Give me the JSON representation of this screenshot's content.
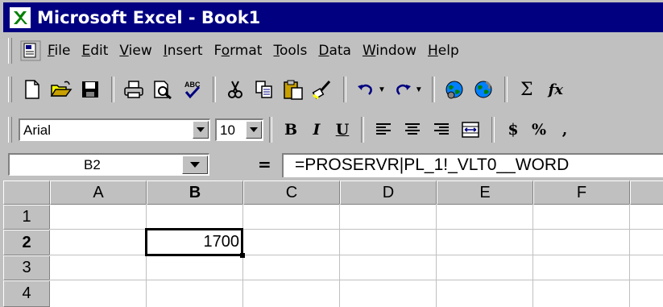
{
  "window": {
    "title": "Microsoft Excel - Book1",
    "accent": "#000080"
  },
  "menu": {
    "items": [
      {
        "label_u": "F",
        "label_rest": "ile"
      },
      {
        "label_u": "E",
        "label_rest": "dit"
      },
      {
        "label_u": "V",
        "label_rest": "iew"
      },
      {
        "label_u": "I",
        "label_rest": "nsert"
      },
      {
        "label_pre": "F",
        "label_u": "o",
        "label_rest": "rmat"
      },
      {
        "label_u": "T",
        "label_rest": "ools"
      },
      {
        "label_u": "D",
        "label_rest": "ata"
      },
      {
        "label_u": "W",
        "label_rest": "indow"
      },
      {
        "label_u": "H",
        "label_rest": "elp"
      }
    ]
  },
  "toolbar": {
    "icons": [
      "new-icon",
      "open-icon",
      "save-icon",
      "print-icon",
      "print-preview-icon",
      "spelling-icon",
      "cut-icon",
      "copy-icon",
      "paste-icon",
      "format-painter-icon",
      "undo-icon",
      "redo-icon",
      "web-toolbar-icon",
      "hyperlink-icon",
      "autosum-icon",
      "paste-function-icon"
    ],
    "sigma": "Σ",
    "fx": "fx"
  },
  "format": {
    "font": "Arial",
    "size": "10",
    "bold": "B",
    "italic": "I",
    "underline": "U",
    "currency": "$",
    "percent": "%",
    "comma": ","
  },
  "formula_bar": {
    "name_box": "B2",
    "equals": "=",
    "formula": "=PROSERVR|PL_1!_VLT0__WORD"
  },
  "sheet": {
    "columns": [
      "A",
      "B",
      "C",
      "D",
      "E",
      "F"
    ],
    "rows": [
      "1",
      "2",
      "3",
      "4"
    ],
    "active_column": "B",
    "active_row": "2",
    "cells": {
      "B2": "1700"
    }
  }
}
